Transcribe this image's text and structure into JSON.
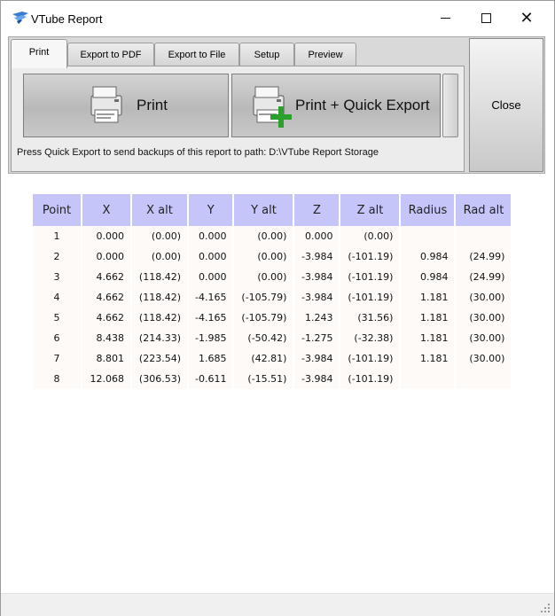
{
  "window": {
    "title": "VTube Report"
  },
  "tabs": [
    {
      "label": "Print",
      "active": true
    },
    {
      "label": "Export to PDF",
      "active": false
    },
    {
      "label": "Export to File",
      "active": false
    },
    {
      "label": "Setup",
      "active": false
    },
    {
      "label": "Preview",
      "active": false
    }
  ],
  "toolbar": {
    "print_label": "Print",
    "print_quick_label": "Print + Quick Export",
    "close_label": "Close",
    "path_note": "Press Quick Export to send backups of this report to path: D:\\VTube Report Storage"
  },
  "table": {
    "headers": [
      "Point",
      "X",
      "X alt",
      "Y",
      "Y alt",
      "Z",
      "Z alt",
      "Radius",
      "Rad alt"
    ],
    "rows": [
      [
        "1",
        "0.000",
        "(0.00)",
        "0.000",
        "(0.00)",
        "0.000",
        "(0.00)",
        "",
        ""
      ],
      [
        "2",
        "0.000",
        "(0.00)",
        "0.000",
        "(0.00)",
        "-3.984",
        "(-101.19)",
        "0.984",
        "(24.99)"
      ],
      [
        "3",
        "4.662",
        "(118.42)",
        "0.000",
        "(0.00)",
        "-3.984",
        "(-101.19)",
        "0.984",
        "(24.99)"
      ],
      [
        "4",
        "4.662",
        "(118.42)",
        "-4.165",
        "(-105.79)",
        "-3.984",
        "(-101.19)",
        "1.181",
        "(30.00)"
      ],
      [
        "5",
        "4.662",
        "(118.42)",
        "-4.165",
        "(-105.79)",
        "1.243",
        "(31.56)",
        "1.181",
        "(30.00)"
      ],
      [
        "6",
        "8.438",
        "(214.33)",
        "-1.985",
        "(-50.42)",
        "-1.275",
        "(-32.38)",
        "1.181",
        "(30.00)"
      ],
      [
        "7",
        "8.801",
        "(223.54)",
        "1.685",
        "(42.81)",
        "-3.984",
        "(-101.19)",
        "1.181",
        "(30.00)"
      ],
      [
        "8",
        "12.068",
        "(306.53)",
        "-0.611",
        "(-15.51)",
        "-3.984",
        "(-101.19)",
        "",
        ""
      ]
    ]
  },
  "colors": {
    "header_bg": "#c5c5fa",
    "cell_bg": "#fdfaf8",
    "icon_plus": "#2ca02c"
  }
}
